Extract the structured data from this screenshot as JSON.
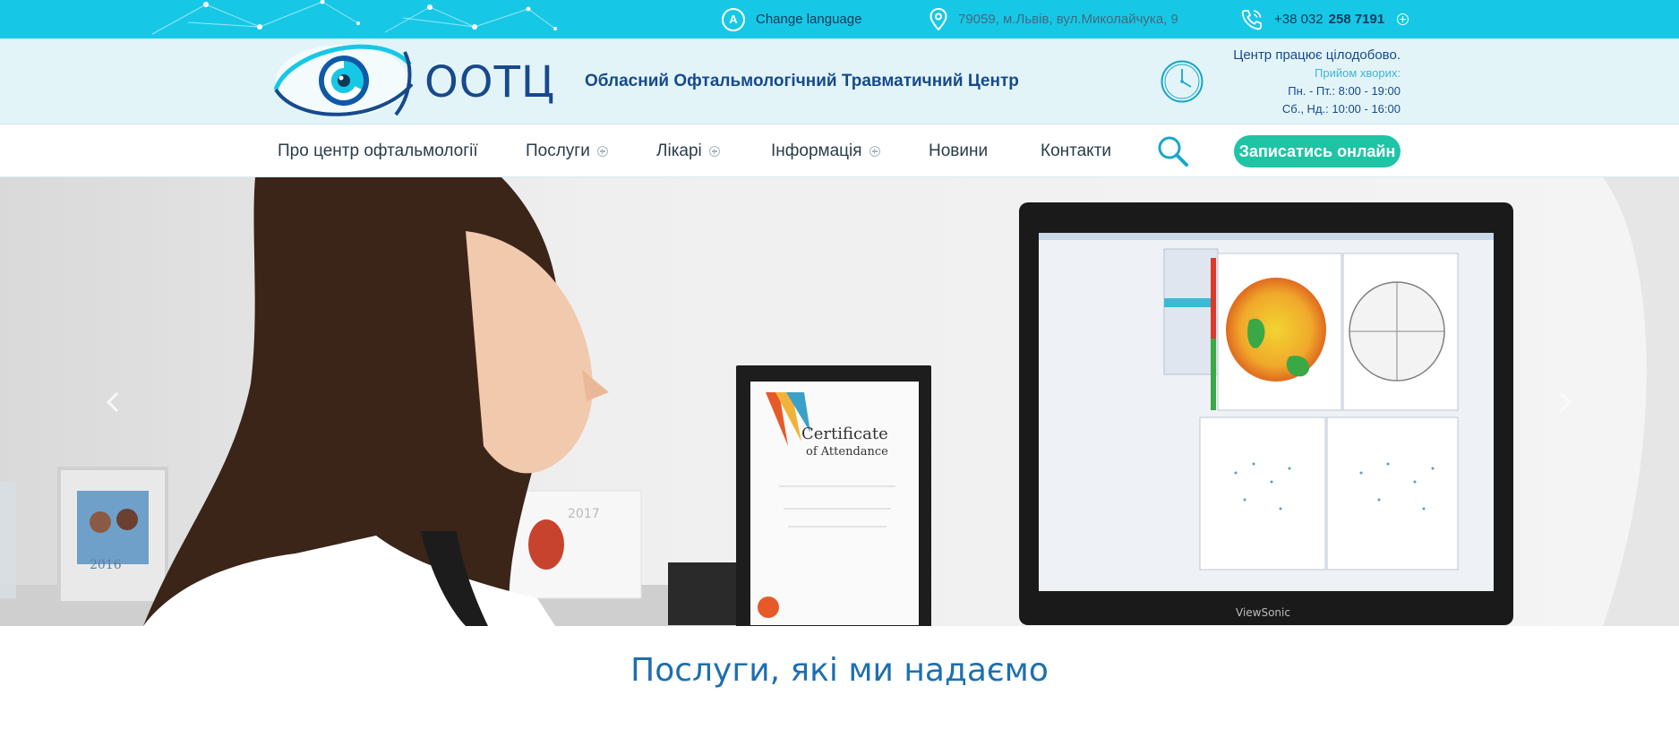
{
  "topbar": {
    "language_label": "Change language",
    "language_icon_letter": "A",
    "address": "79059, м.Львів, вул.Миколайчука, 9",
    "phone_prefix": "+38 032",
    "phone_number": "258 7191"
  },
  "header": {
    "logo_text": "ООТЦ",
    "center_name": "Обласний Офтальмологічний Травматичний Центр",
    "hours": {
      "line1": "Центр працює цілодобово.",
      "line2": "Прийом хворих:",
      "line3": "Пн. - Пт.: 8:00 - 19:00",
      "line4": "Сб., Нд.: 10:00 - 16:00"
    }
  },
  "nav": {
    "items": [
      {
        "label": "Про центр офтальмології",
        "has_submenu": false
      },
      {
        "label": "Послуги",
        "has_submenu": true
      },
      {
        "label": "Лікарі",
        "has_submenu": true
      },
      {
        "label": "Інформація",
        "has_submenu": true
      },
      {
        "label": "Новини",
        "has_submenu": false
      },
      {
        "label": "Контакти",
        "has_submenu": false
      }
    ],
    "book_button": "Записатись онлайн"
  },
  "hero": {
    "certificate_title": "Certificate",
    "certificate_subtitle": "of Attendance",
    "monitor_brand": "ViewSonic",
    "calendar_year": "2017",
    "photo_year": "2016"
  },
  "section": {
    "title": "Послуги, які ми надаємо"
  },
  "colors": {
    "topbar": "#17c8e6",
    "header_bg": "#e3f4f9",
    "brand_blue": "#164a8c",
    "accent_green": "#1fc4a4",
    "title_blue": "#1d6fb0"
  },
  "icons": {
    "language": "language-icon",
    "address": "map-pin-icon",
    "phone": "phone-icon",
    "clock": "clock-icon",
    "search": "search-icon"
  }
}
